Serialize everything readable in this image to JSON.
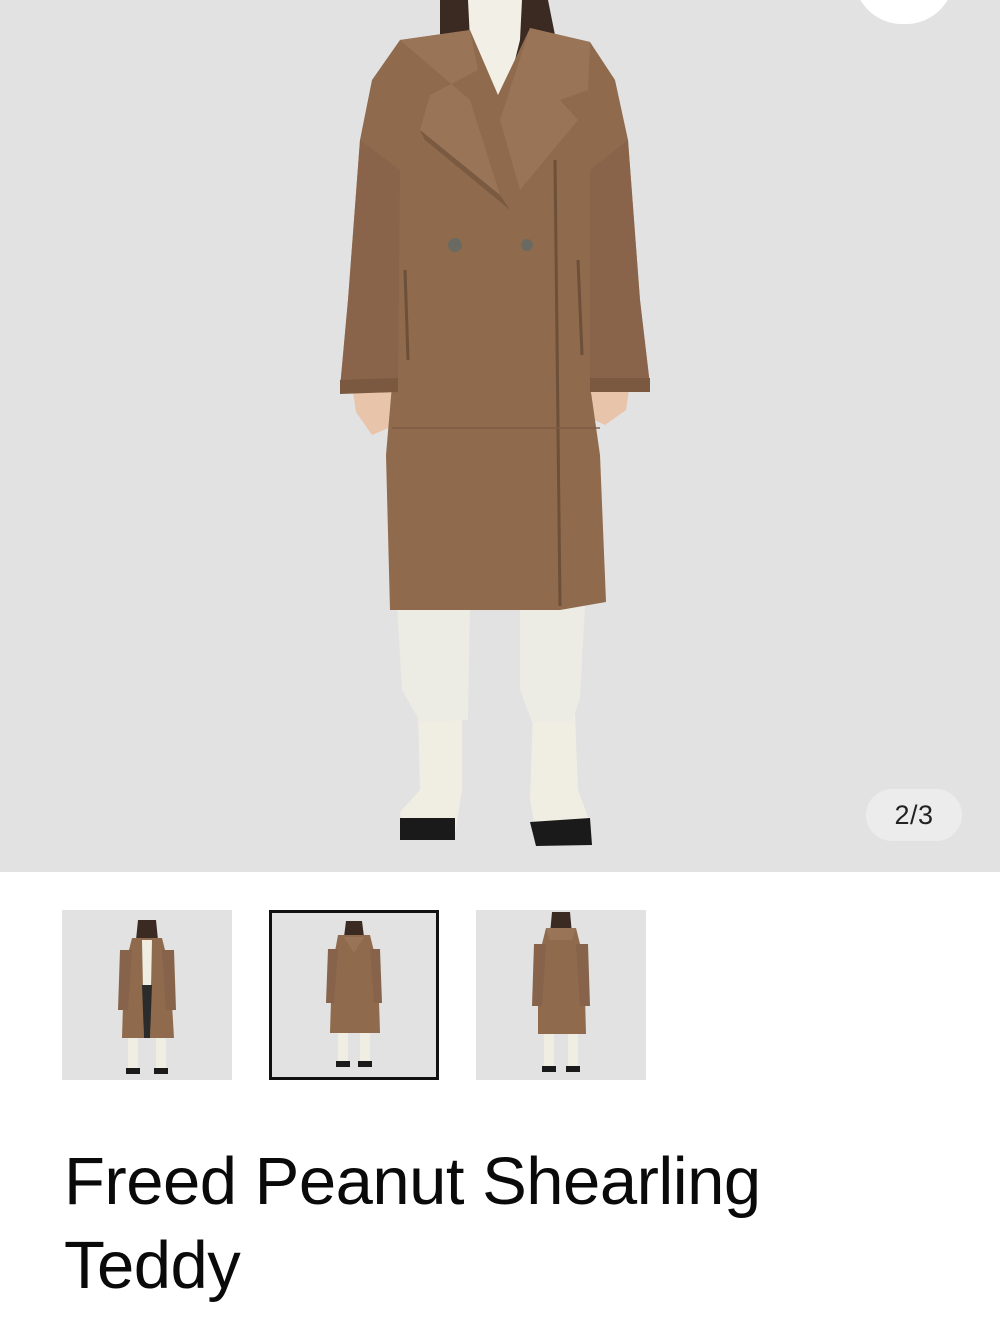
{
  "product": {
    "title": "Freed Peanut Shearling Teddy",
    "coat_color": "#8f6a4c"
  },
  "gallery": {
    "counter": "2/3",
    "current_index": 2,
    "total": 3,
    "thumbnails": [
      {
        "view": "front-open",
        "selected": false
      },
      {
        "view": "front-closed",
        "selected": true
      },
      {
        "view": "back",
        "selected": false
      }
    ]
  }
}
